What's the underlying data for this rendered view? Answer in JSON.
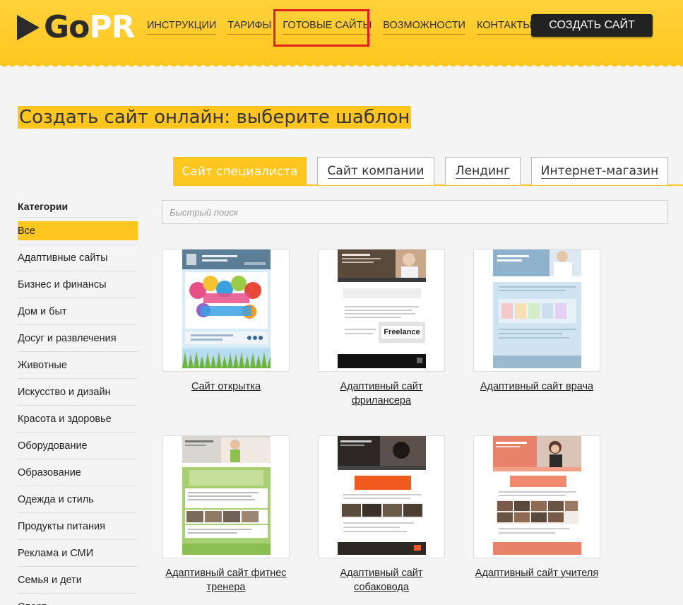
{
  "header": {
    "logo_go": "Go",
    "logo_pr": "PR",
    "nav": [
      "ИНСТРУКЦИИ",
      "ТАРИФЫ",
      "ГОТОВЫЕ САЙТЫ",
      "ВОЗМОЖНОСТИ",
      "КОНТАКТЫ"
    ],
    "create_label": "СОЗДАТЬ САЙТ"
  },
  "page_title": "Создать сайт онлайн: выберите шаблон",
  "tabs": [
    "Сайт специалиста",
    "Сайт компании",
    "Лендинг",
    "Интернет-магазин"
  ],
  "sidebar": {
    "title": "Категории",
    "items": [
      "Все",
      "Адаптивные сайты",
      "Бизнес и финансы",
      "Дом и быт",
      "Досуг и развлечения",
      "Животные",
      "Искусство и дизайн",
      "Красота и здоровье",
      "Оборудование",
      "Образование",
      "Одежда и стиль",
      "Продукты питания",
      "Реклама и СМИ",
      "Семья и дети",
      "Спорт"
    ]
  },
  "search": {
    "placeholder": "Быстрый поиск"
  },
  "templates": [
    {
      "title": "Сайт открытка"
    },
    {
      "title": "Адаптивный сайт фрилансера",
      "badge": "Freelance"
    },
    {
      "title": "Адаптивный сайт врача"
    },
    {
      "title": "Адаптивный сайт фитнес тренера"
    },
    {
      "title": "Адаптивный сайт собаковода"
    },
    {
      "title": "Адаптивный сайт учителя"
    }
  ],
  "colors": {
    "accent": "#ffc61f",
    "dark": "#222222",
    "highlight": "#e0201c"
  }
}
